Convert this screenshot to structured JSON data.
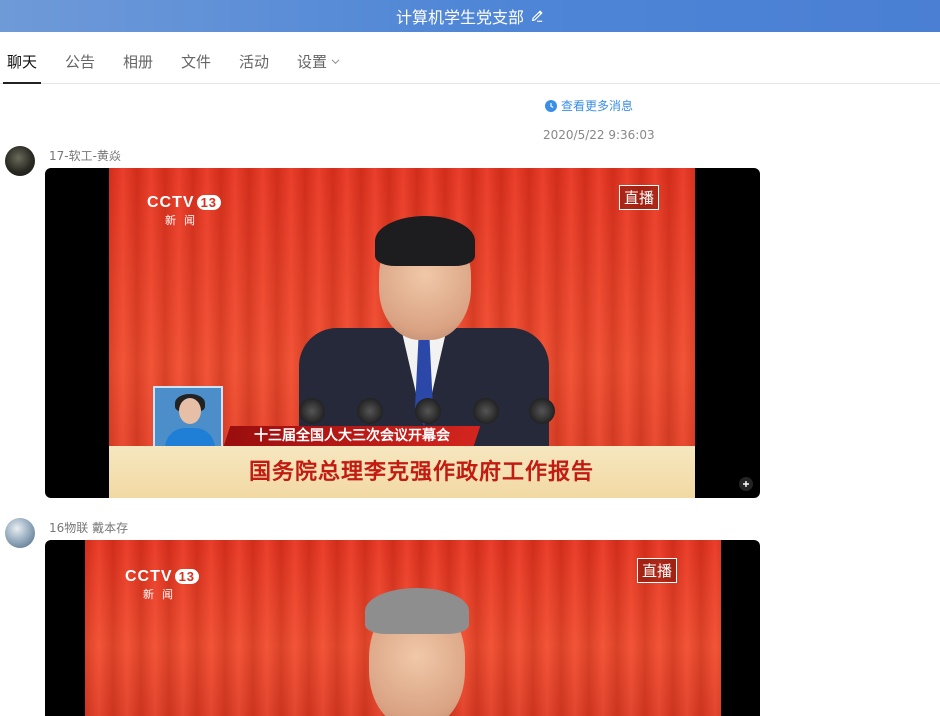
{
  "window": {
    "title": "计算机学生党支部",
    "edit_icon": "pencil-icon"
  },
  "tabs": [
    {
      "label": "聊天",
      "active": true
    },
    {
      "label": "公告",
      "active": false
    },
    {
      "label": "相册",
      "active": false
    },
    {
      "label": "文件",
      "active": false
    },
    {
      "label": "活动",
      "active": false
    },
    {
      "label": "设置",
      "active": false,
      "dropdown": true
    }
  ],
  "chat": {
    "more_messages": "查看更多消息",
    "timestamp": "2020/5/22 9:36:03",
    "messages": [
      {
        "sender": "17-软工-黄焱",
        "video": {
          "logo": "CCTV",
          "channel": "13",
          "channel_sub": "新闻",
          "live_badge": "直播",
          "caption_top": "十三届全国人大三次会议开幕会",
          "caption_main": "国务院总理李克强作政府工作报告"
        }
      },
      {
        "sender": "16物联 戴本存",
        "video": {
          "logo": "CCTV",
          "channel": "13",
          "channel_sub": "新闻",
          "live_badge": "直播"
        }
      }
    ]
  },
  "colors": {
    "titlebar": "#4f86d6",
    "link": "#3a8ee6",
    "stage_red": "#e8321e"
  }
}
